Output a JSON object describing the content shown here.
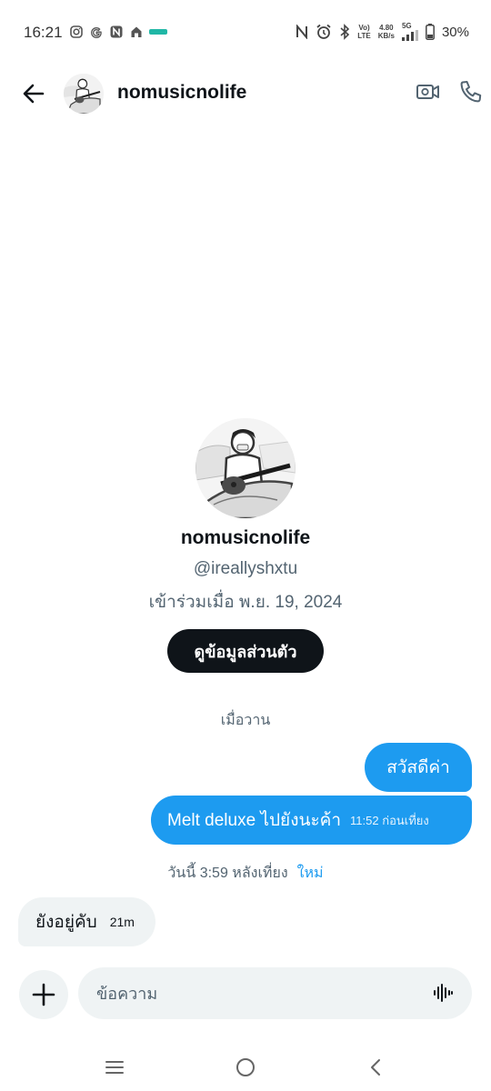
{
  "status_bar": {
    "time": "16:21",
    "network_speed_value": "4.80",
    "network_speed_unit": "KB/s",
    "volte": "Vo)",
    "lte": "LTE",
    "network_type": "5G",
    "battery": "30%"
  },
  "header": {
    "name": "nomusicnolife"
  },
  "profile": {
    "name": "nomusicnolife",
    "handle": "@ireallyshxtu",
    "joined": "เข้าร่วมเมื่อ พ.ย. 19, 2024",
    "view_profile_label": "ดูข้อมูลส่วนตัว"
  },
  "messages": {
    "day_separator": "เมื่อวาน",
    "outgoing_1": "สวัสดีค่า",
    "outgoing_2": "Melt deluxe ไปยังนะค้า",
    "outgoing_2_time": "11:52 ก่อนเที่ยง",
    "read_status": "วันนี้ 3:59 หลังเที่ยง",
    "new_label": "ใหม่",
    "incoming_1": "ยังอยู่คับ",
    "incoming_1_time": "21m"
  },
  "composer": {
    "placeholder": "ข้อความ"
  },
  "colors": {
    "accent": "#1d9bf0",
    "bubble_in": "#eff3f4",
    "text_primary": "#0f1419",
    "text_secondary": "#536471"
  }
}
